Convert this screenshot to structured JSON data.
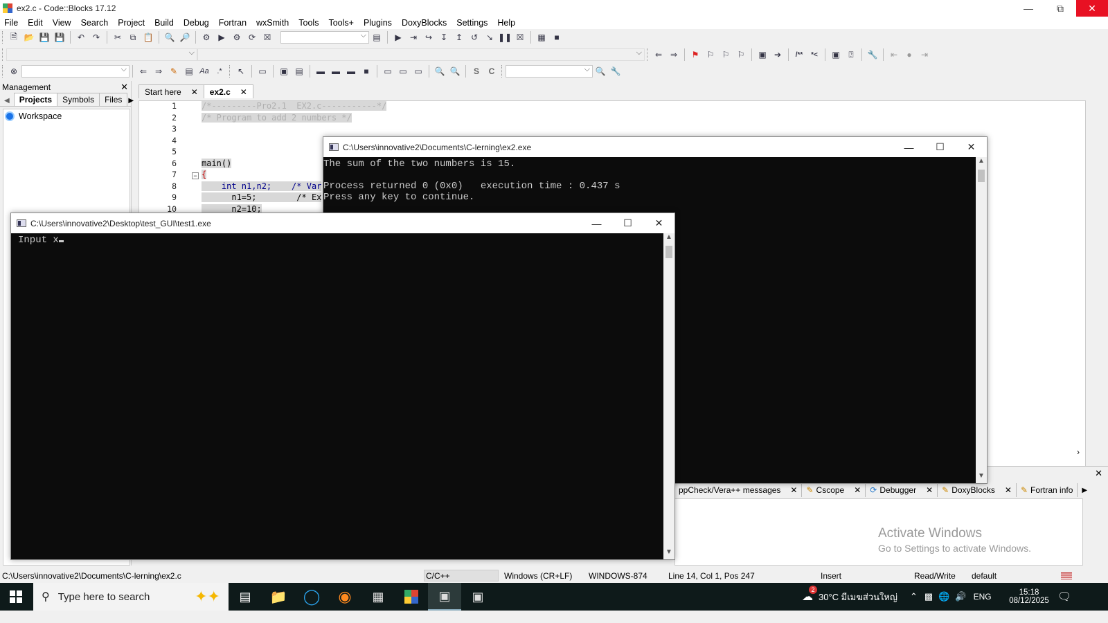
{
  "window": {
    "title": "ex2.c - Code::Blocks 17.12"
  },
  "menu": [
    "File",
    "Edit",
    "View",
    "Search",
    "Project",
    "Build",
    "Debug",
    "Fortran",
    "wxSmith",
    "Tools",
    "Tools+",
    "Plugins",
    "DoxyBlocks",
    "Settings",
    "Help"
  ],
  "management": {
    "title": "Management",
    "tabs": [
      "Projects",
      "Symbols",
      "Files"
    ],
    "tree": [
      "Workspace"
    ]
  },
  "editor": {
    "tabs": [
      {
        "label": "Start here"
      },
      {
        "label": "ex2.c",
        "active": true
      }
    ],
    "line_numbers": [
      "1",
      "2",
      "3",
      "4",
      "5",
      "6",
      "7",
      "8",
      "9",
      "10"
    ],
    "lines": [
      "/*---------Pro2.1  EX2.c-----------*/",
      "/* Program to add 2 numbers */",
      "",
      "",
      "",
      "main()",
      "{",
      "    int n1,n2;    /* Var",
      "      n1=5;        /* Ex",
      "      n2=10;"
    ]
  },
  "console_ex2": {
    "title": "C:\\Users\\innovative2\\Documents\\C-lerning\\ex2.exe",
    "lines": [
      "The sum of the two numbers is 15.",
      "",
      "Process returned 0 (0x0)   execution time : 0.437 s",
      "Press any key to continue."
    ]
  },
  "console_test1": {
    "title": "C:\\Users\\innovative2\\Desktop\\test_GUI\\test1.exe",
    "prompt": "Input x"
  },
  "logs": {
    "tabs": [
      "ppCheck/Vera++ messages",
      "Cscope",
      "Debugger",
      "DoxyBlocks",
      "Fortran info"
    ]
  },
  "activate": {
    "title": "Activate Windows",
    "subtitle": "Go to Settings to activate Windows."
  },
  "statusbar": {
    "path": "C:\\Users\\innovative2\\Documents\\C-lerning\\ex2.c",
    "language": "C/C++",
    "line_endings": "Windows (CR+LF)",
    "encoding": "WINDOWS-874",
    "position": "Line 14, Col 1, Pos 247",
    "mode": "Insert",
    "access": "Read/Write",
    "profile": "default"
  },
  "taskbar": {
    "search_placeholder": "Type here to search",
    "weather": "30°C  มีเมฆส่วนใหญ่",
    "notification_badge": "2",
    "language": "ENG",
    "time": "15:18",
    "date": "08/12/2025"
  }
}
